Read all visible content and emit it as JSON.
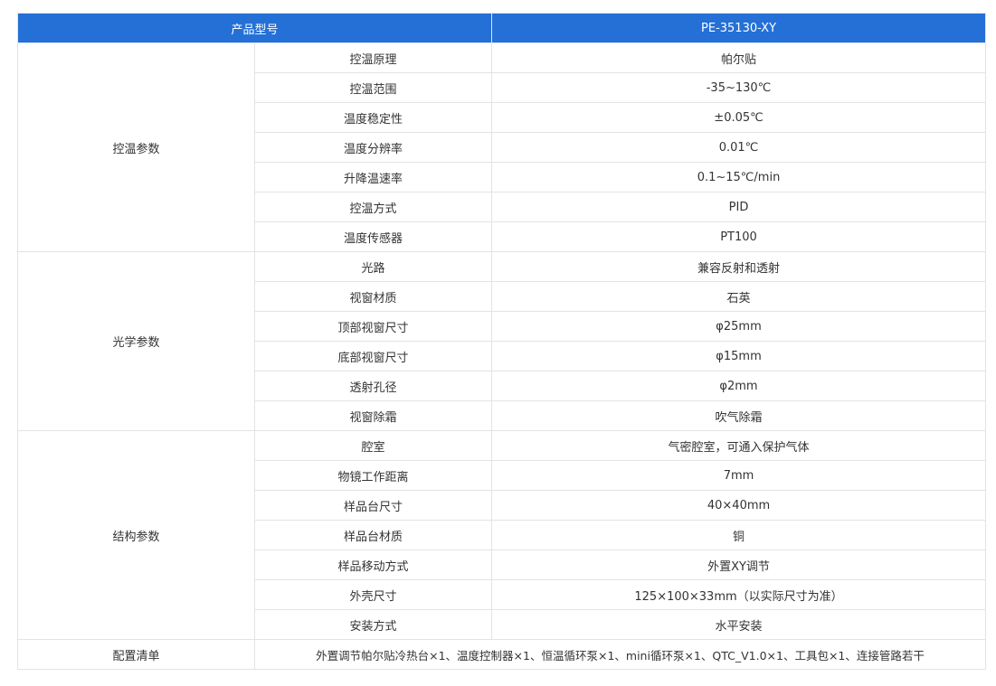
{
  "header": {
    "left_label": "产品型号",
    "model": "PE-35130-XY"
  },
  "groups": [
    {
      "name": "控温参数",
      "rows": [
        {
          "param": "控温原理",
          "value": "帕尔贴"
        },
        {
          "param": "控温范围",
          "value": "-35~130℃"
        },
        {
          "param": "温度稳定性",
          "value": "±0.05℃"
        },
        {
          "param": "温度分辨率",
          "value": "0.01℃"
        },
        {
          "param": "升降温速率",
          "value": "0.1~15℃/min"
        },
        {
          "param": "控温方式",
          "value": "PID"
        },
        {
          "param": "温度传感器",
          "value": "PT100"
        }
      ]
    },
    {
      "name": "光学参数",
      "rows": [
        {
          "param": "光路",
          "value": "兼容反射和透射"
        },
        {
          "param": "视窗材质",
          "value": "石英"
        },
        {
          "param": "顶部视窗尺寸",
          "value": "φ25mm"
        },
        {
          "param": "底部视窗尺寸",
          "value": "φ15mm"
        },
        {
          "param": "透射孔径",
          "value": "φ2mm"
        },
        {
          "param": "视窗除霜",
          "value": "吹气除霜"
        }
      ]
    },
    {
      "name": "结构参数",
      "rows": [
        {
          "param": "腔室",
          "value": "气密腔室，可通入保护气体"
        },
        {
          "param": "物镜工作距离",
          "value": "7mm"
        },
        {
          "param": "样品台尺寸",
          "value": "40×40mm"
        },
        {
          "param": "样品台材质",
          "value": "铜"
        },
        {
          "param": "样品移动方式",
          "value": "外置XY调节"
        },
        {
          "param": "外壳尺寸",
          "value": "125×100×33mm（以实际尺寸为准）"
        },
        {
          "param": "安装方式",
          "value": "水平安装"
        }
      ]
    }
  ],
  "config": {
    "label": "配置清单",
    "value": "外置调节帕尔贴冷热台×1、温度控制器×1、恒温循环泵×1、mini循环泵×1、QTC_V1.0×1、工具包×1、连接管路若干"
  },
  "colors": {
    "header_bg": "#2470d6",
    "header_text": "#ffffff",
    "border": "#e3e3e3",
    "text": "#333333"
  }
}
